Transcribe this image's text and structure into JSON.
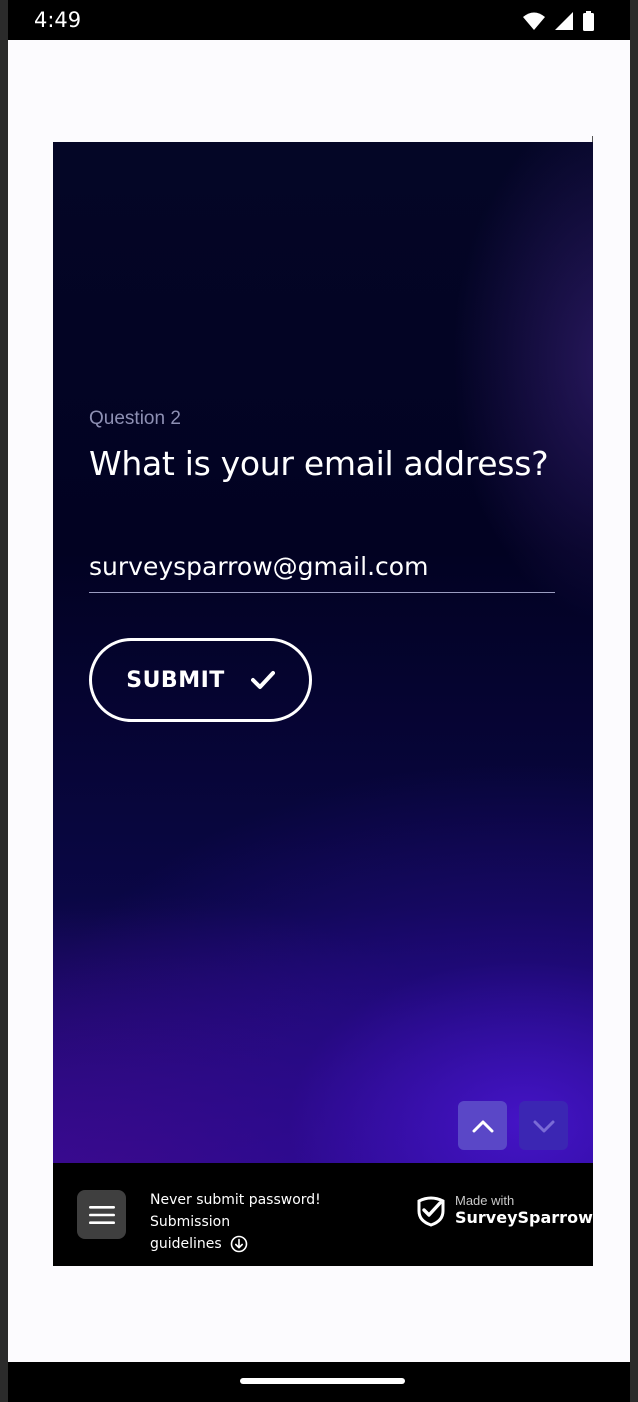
{
  "status_bar": {
    "time": "4:49"
  },
  "question": {
    "number_label": "Question 2",
    "title": "What is your email address?"
  },
  "answer": {
    "email_value": "surveysparrow@gmail.com"
  },
  "submit": {
    "label": "SUBMIT"
  },
  "footer": {
    "notice_line1": "Never submit password! Submission",
    "notice_link": "guidelines",
    "made_with": "Made with",
    "brand_name": "SurveySparrow"
  },
  "colors": {
    "nav_up_bg": "#5a47c7",
    "nav_down_bg": "#3b26b3",
    "footer_bg": "#000000"
  }
}
